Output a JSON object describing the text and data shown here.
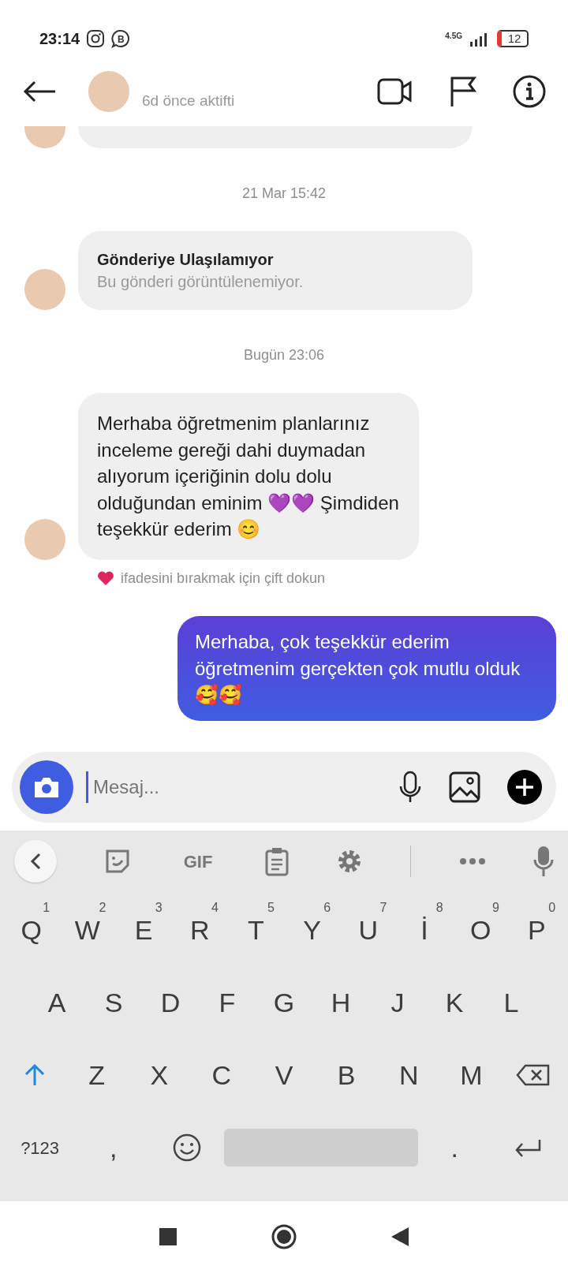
{
  "status_bar": {
    "time": "23:14",
    "app_badge": "B",
    "network": "4.5G",
    "battery": "12"
  },
  "header": {
    "last_seen": "6d önce aktifti"
  },
  "messages": [
    {
      "kind": "received_cut"
    },
    {
      "kind": "time",
      "text": "21 Mar 15:42"
    },
    {
      "kind": "post",
      "title": "Gönderiye Ulaşılamıyor",
      "text": "Bu gönderi görüntülenemiyor."
    },
    {
      "kind": "time",
      "text": "Bugün 23:06"
    },
    {
      "kind": "received",
      "text": "Merhaba öğretmenim planlarınız inceleme gereği dahi duymadan alıyorum içeriğinin dolu dolu olduğundan eminim 💜💜 Şimdiden teşekkür ederim 😊"
    },
    {
      "kind": "hint",
      "text": "ifadesini bırakmak için çift dokun"
    },
    {
      "kind": "sent",
      "text": "Merhaba, çok teşekkür ederim öğretmenim gerçekten çok mutlu olduk🥰🥰"
    }
  ],
  "composer": {
    "placeholder": "Mesaj..."
  },
  "keyboard": {
    "toolbar_label": "GIF",
    "rows": [
      [
        {
          "label": "Q",
          "hint": "1"
        },
        {
          "label": "W",
          "hint": "2"
        },
        {
          "label": "E",
          "hint": "3"
        },
        {
          "label": "R",
          "hint": "4"
        },
        {
          "label": "T",
          "hint": "5"
        },
        {
          "label": "Y",
          "hint": "6"
        },
        {
          "label": "U",
          "hint": "7"
        },
        {
          "label": "İ",
          "hint": "8"
        },
        {
          "label": "O",
          "hint": "9"
        },
        {
          "label": "P",
          "hint": "0"
        }
      ],
      [
        {
          "label": "A"
        },
        {
          "label": "S"
        },
        {
          "label": "D"
        },
        {
          "label": "F"
        },
        {
          "label": "G"
        },
        {
          "label": "H"
        },
        {
          "label": "J"
        },
        {
          "label": "K"
        },
        {
          "label": "L"
        }
      ],
      [
        {
          "kind": "shift"
        },
        {
          "label": "Z"
        },
        {
          "label": "X"
        },
        {
          "label": "C"
        },
        {
          "label": "V"
        },
        {
          "label": "B"
        },
        {
          "label": "N"
        },
        {
          "label": "M"
        },
        {
          "kind": "backspace"
        }
      ],
      [
        {
          "label": "?123",
          "kind": "mode"
        },
        {
          "label": ","
        },
        {
          "kind": "emoji"
        },
        {
          "kind": "space"
        },
        {
          "label": "."
        },
        {
          "kind": "enter"
        }
      ]
    ]
  }
}
